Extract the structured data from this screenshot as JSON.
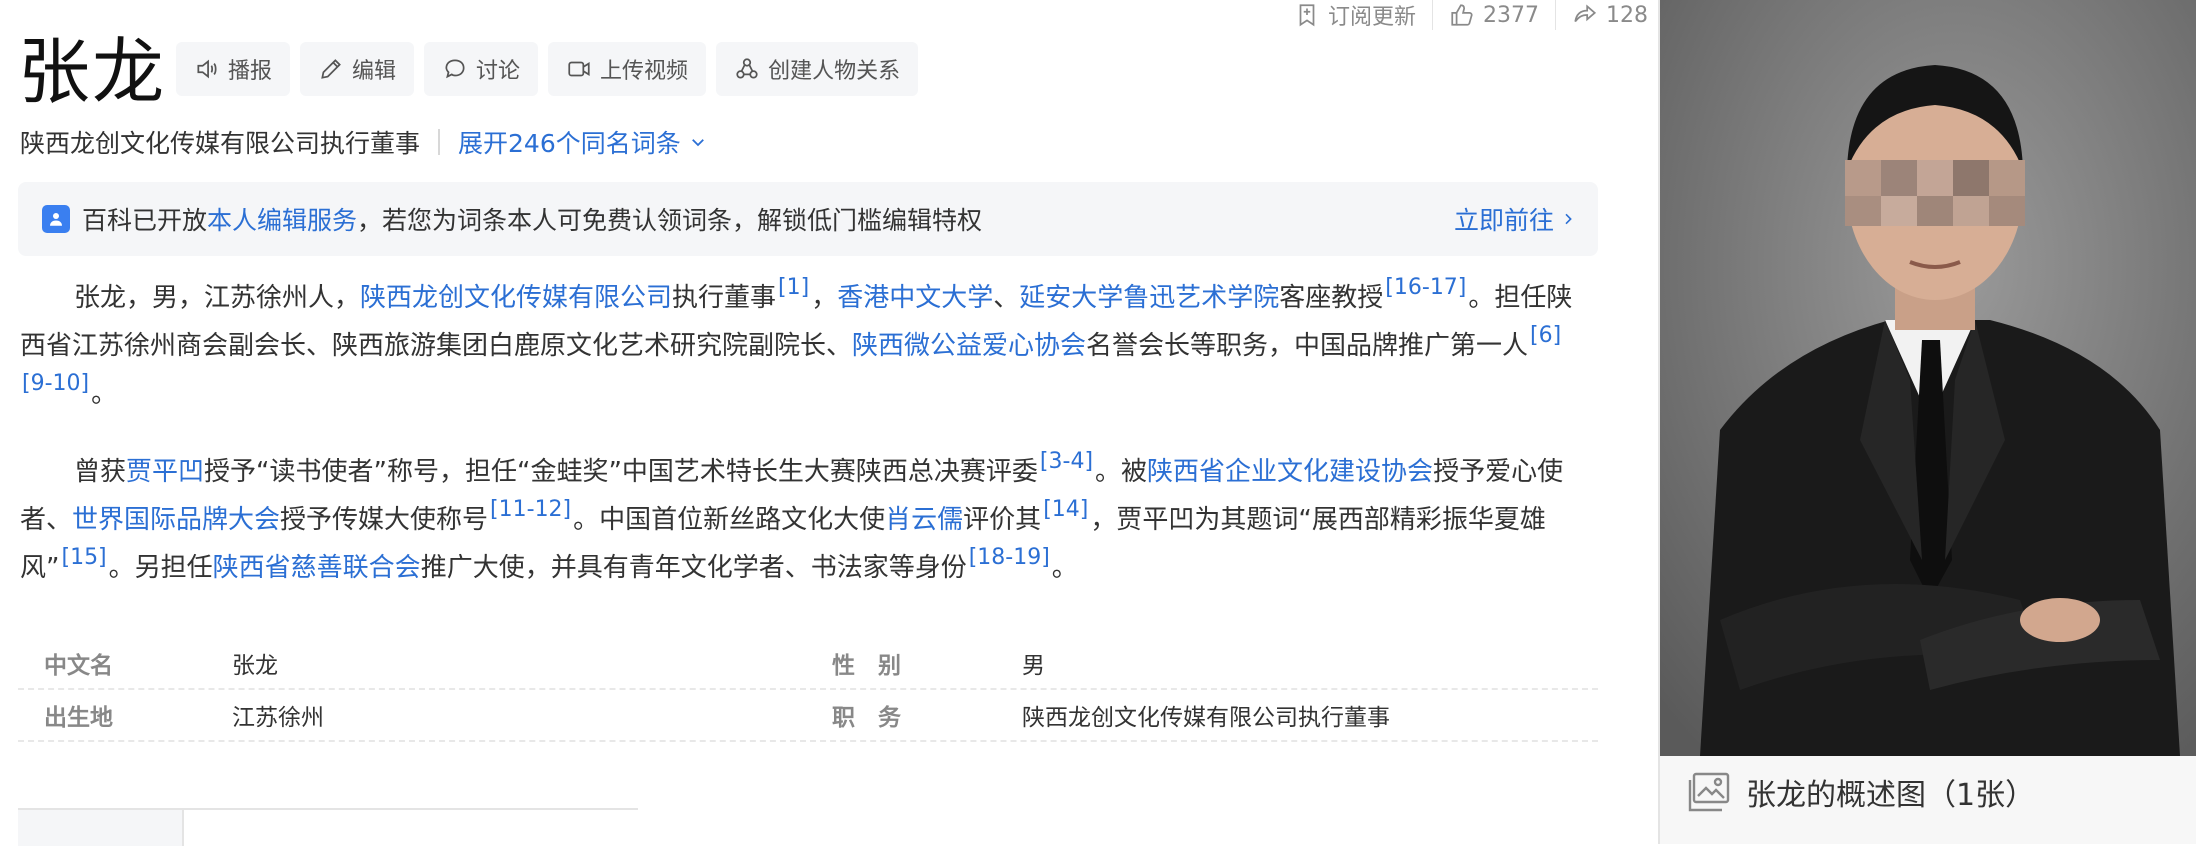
{
  "topbar": {
    "subscribe": "订阅更新",
    "likes": "2377",
    "shares": "128"
  },
  "title": "张龙",
  "tools": {
    "broadcast": "播报",
    "edit": "编辑",
    "discuss": "讨论",
    "upload_video": "上传视频",
    "create_relation": "创建人物关系"
  },
  "subtitle": {
    "desc": "陕西龙创文化传媒有限公司执行董事",
    "expand": "展开246个同名词条"
  },
  "notice": {
    "text_before": "百科已开放",
    "link": "本人编辑服务",
    "text_after": "，若您为词条本人可免费认领词条，解锁低门槛编辑特权",
    "go": "立即前往"
  },
  "para1": {
    "t1": "张龙，男，江苏徐州人，",
    "l1": "陕西龙创文化传媒有限公司",
    "t2": "执行董事",
    "r1": "[1]",
    "t3": "，",
    "l2": "香港中文大学",
    "t4": "、",
    "l3": "延安大学鲁迅艺术学院",
    "t5": "客座教授",
    "r2": "[16-17]",
    "t6": "。担任陕西省江苏徐州商会副会长、陕西旅游集团白鹿原文化艺术研究院副院长、",
    "l4": "陕西微公益爱心协会",
    "t7": "名誉会长等职务，中国品牌推广第一人",
    "r3": "[6]",
    "r4": "[9-10]",
    "t8": "。"
  },
  "para2": {
    "t1": "曾获",
    "l1": "贾平凹",
    "t2": "授予“读书使者”称号，担任“金蛙奖”中国艺术特长生大赛陕西总决赛评委",
    "r1": "[3-4]",
    "t3": "。被",
    "l2": "陕西省企业文化建设协会",
    "t4": "授予爱心使者、",
    "l3": "世界国际品牌大会",
    "t5": "授予传媒大使称号",
    "r2": "[11-12]",
    "t6": "。中国首位新丝路文化大使",
    "l4": "肖云儒",
    "t7": "评价其",
    "r3": "[14]",
    "t8": "，贾平凹为其题词“展西部精彩振华夏雄风”",
    "r4": "[15]",
    "t9": "。另担任",
    "l5": "陕西省慈善联合会",
    "t10": "推广大使，并具有青年文化学者、书法家等身份",
    "r5": "[18-19]",
    "t11": "。"
  },
  "info": [
    {
      "k1": "中文名",
      "v1": "张龙",
      "k2": "性　别",
      "v2": "男"
    },
    {
      "k1": "出生地",
      "v1": "江苏徐州",
      "k2": "职　务",
      "v2": "陕西龙创文化传媒有限公司执行董事"
    }
  ],
  "photo": {
    "caption": "张龙的概述图（1张）"
  },
  "colors": {
    "link": "#2b6fd4",
    "notice_icon": "#3a7ff0",
    "tool_bg": "#f5f6f8"
  }
}
